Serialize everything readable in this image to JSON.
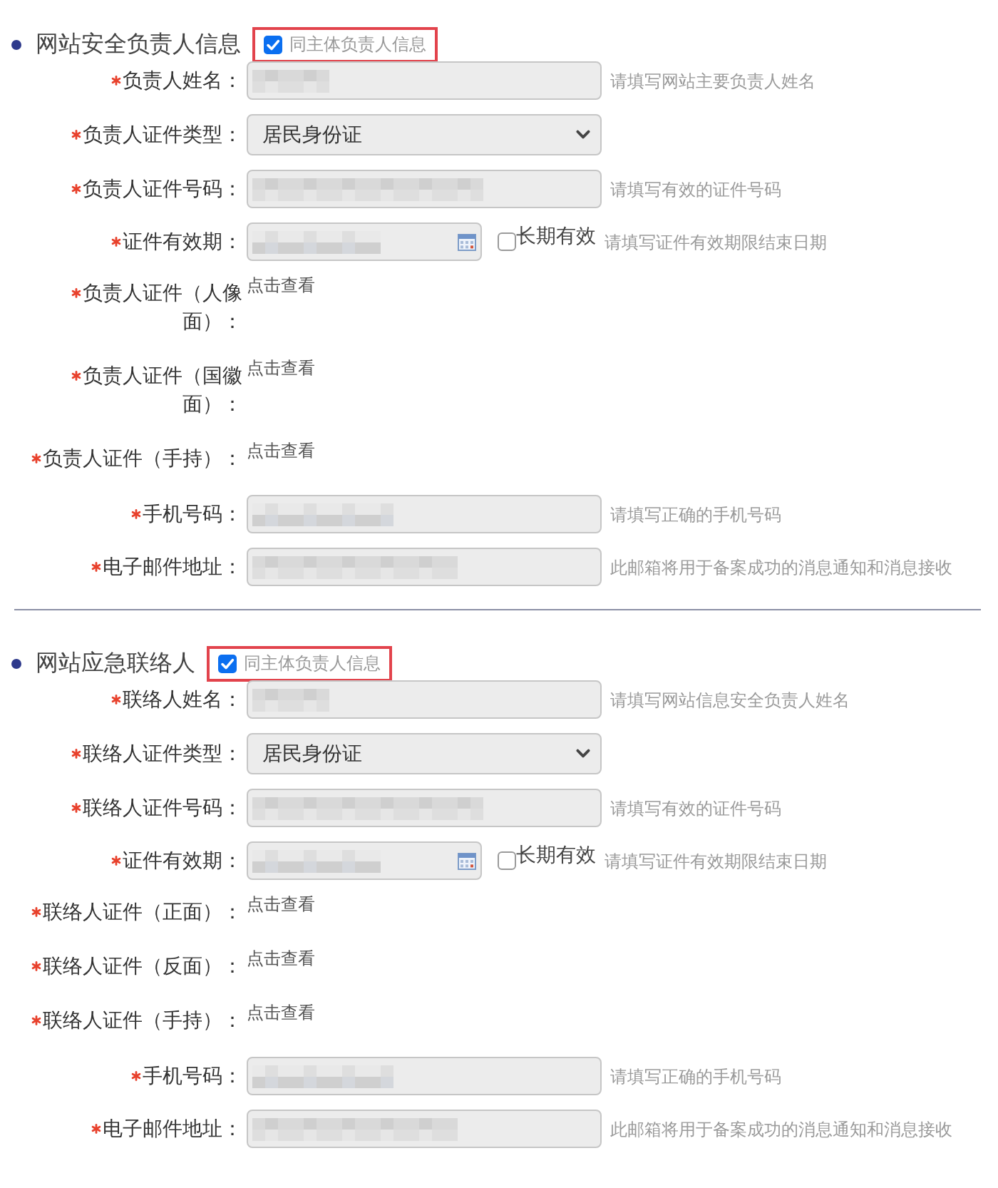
{
  "sections": [
    {
      "title": "网站安全负责人信息",
      "same_as_principal": {
        "label": "同主体负责人信息",
        "checked": true,
        "highlighted": true
      },
      "fields": [
        {
          "kind": "text",
          "label": "负责人姓名：",
          "required": true,
          "disabled": true,
          "masked": true,
          "hint": "请填写网站主要负责人姓名"
        },
        {
          "kind": "select",
          "label": "负责人证件类型：",
          "required": true,
          "disabled": true,
          "value": "居民身份证"
        },
        {
          "kind": "text",
          "label": "负责人证件号码：",
          "required": true,
          "disabled": true,
          "masked": true,
          "hint": "请填写有效的证件号码"
        },
        {
          "kind": "date",
          "label": "证件有效期：",
          "required": true,
          "disabled": true,
          "masked": true,
          "long_term": {
            "label": "长期有效",
            "checked": false
          },
          "hint": "请填写证件有效期限结束日期"
        },
        {
          "kind": "link",
          "label": "负责人证件（人像面）：",
          "required": true,
          "link": "点击查看"
        },
        {
          "kind": "link",
          "label": "负责人证件（国徽面）：",
          "required": true,
          "link": "点击查看"
        },
        {
          "kind": "link",
          "label": "负责人证件（手持）：",
          "required": true,
          "link": "点击查看"
        },
        {
          "kind": "text",
          "label": "手机号码：",
          "required": true,
          "disabled": true,
          "masked": true,
          "hint": "请填写正确的手机号码"
        },
        {
          "kind": "text",
          "label": "电子邮件地址：",
          "required": true,
          "disabled": true,
          "masked": true,
          "hint": "此邮箱将用于备案成功的消息通知和消息接收"
        }
      ]
    },
    {
      "title": "网站应急联络人",
      "same_as_principal": {
        "label": "同主体负责人信息",
        "checked": true,
        "highlighted": true
      },
      "fields": [
        {
          "kind": "text",
          "label": "联络人姓名：",
          "required": true,
          "disabled": true,
          "masked": true,
          "hint": "请填写网站信息安全负责人姓名"
        },
        {
          "kind": "select",
          "label": "联络人证件类型：",
          "required": true,
          "disabled": true,
          "value": "居民身份证"
        },
        {
          "kind": "text",
          "label": "联络人证件号码：",
          "required": true,
          "disabled": true,
          "masked": true,
          "hint": "请填写有效的证件号码"
        },
        {
          "kind": "date",
          "label": "证件有效期：",
          "required": true,
          "disabled": true,
          "masked": true,
          "long_term": {
            "label": "长期有效",
            "checked": false
          },
          "hint": "请填写证件有效期限结束日期"
        },
        {
          "kind": "link",
          "label": "联络人证件（正面）：",
          "required": true,
          "link": "点击查看"
        },
        {
          "kind": "link",
          "label": "联络人证件（反面）：",
          "required": true,
          "link": "点击查看"
        },
        {
          "kind": "link",
          "label": "联络人证件（手持）：",
          "required": true,
          "link": "点击查看"
        },
        {
          "kind": "text",
          "label": "手机号码：",
          "required": true,
          "disabled": true,
          "masked": true,
          "hint": "请填写正确的手机号码"
        },
        {
          "kind": "text",
          "label": "电子邮件地址：",
          "required": true,
          "disabled": true,
          "masked": true,
          "hint": "此邮箱将用于备案成功的消息通知和消息接收"
        }
      ]
    }
  ]
}
